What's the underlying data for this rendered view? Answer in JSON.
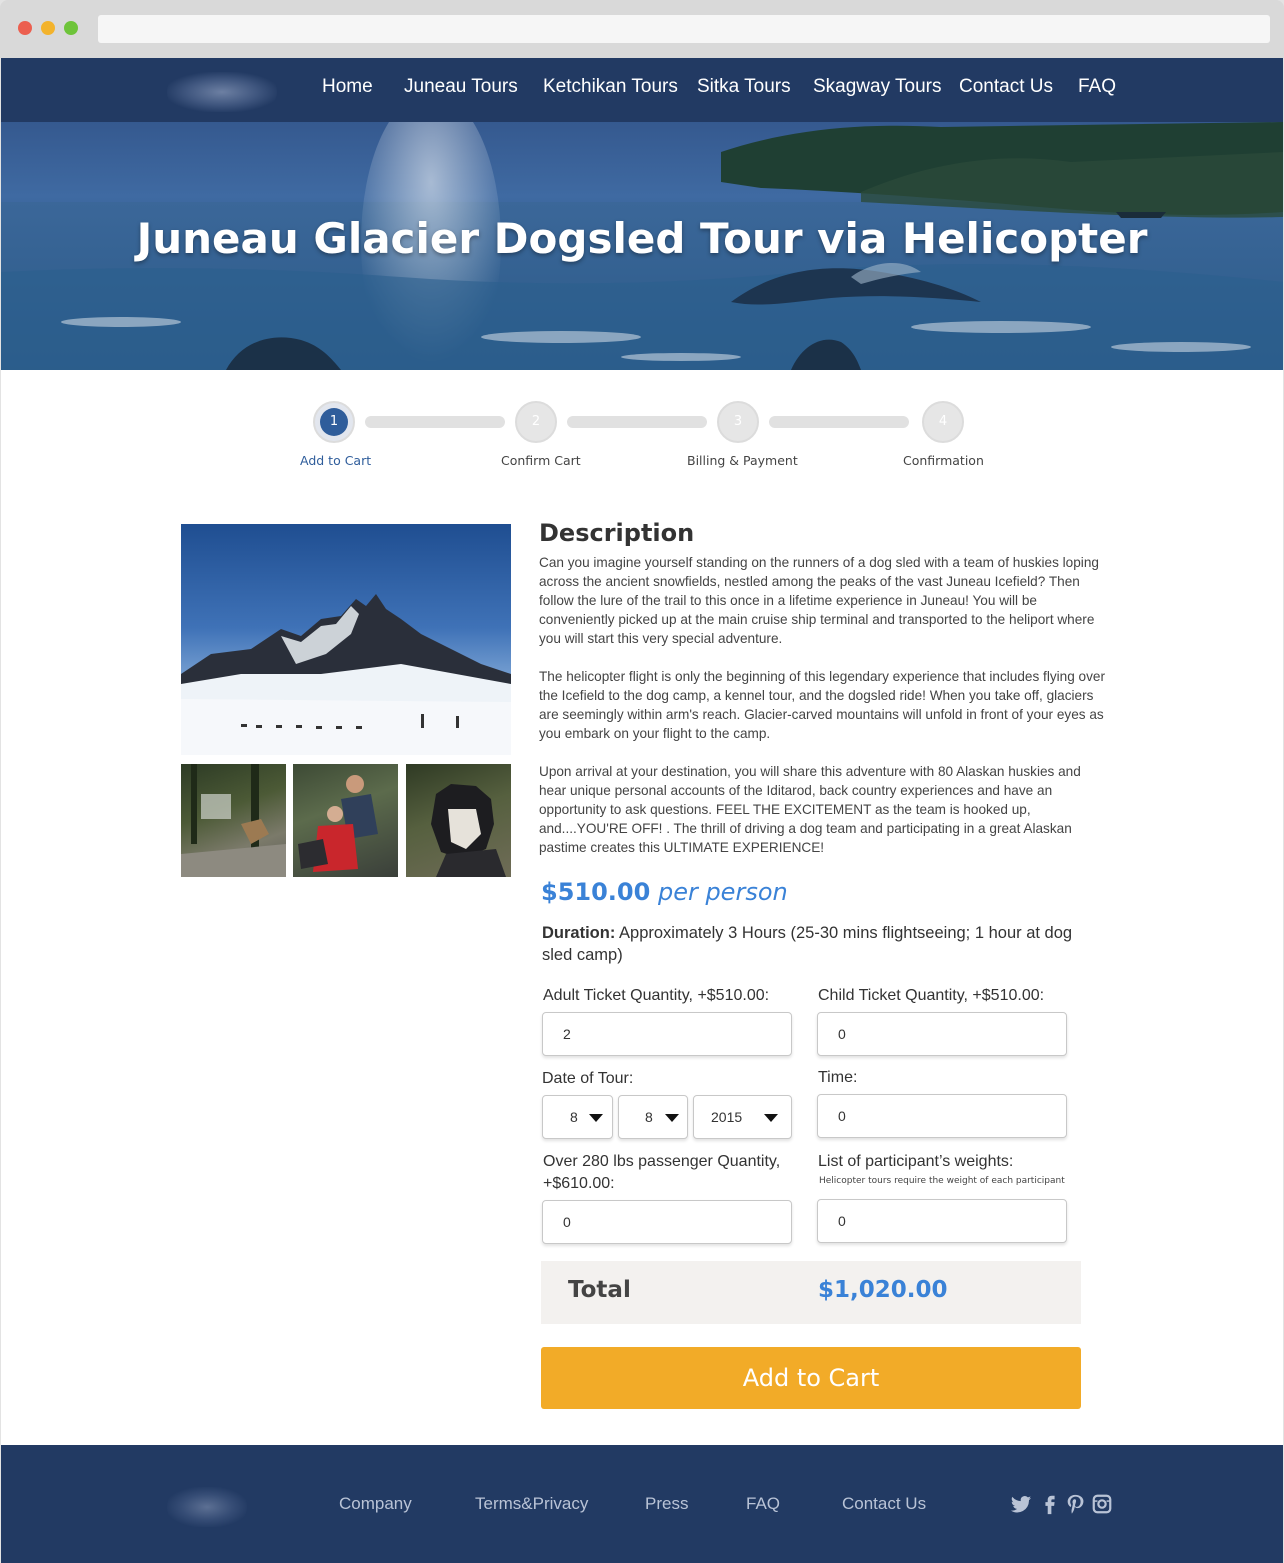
{
  "nav": {
    "items": [
      "Home",
      "Juneau Tours",
      "Ketchikan Tours",
      "Sitka Tours",
      "Skagway Tours",
      "Contact Us",
      "FAQ"
    ]
  },
  "hero": {
    "title": "Juneau Glacier Dogsled Tour via Helicopter"
  },
  "stepper": {
    "current": 1,
    "steps": [
      {
        "num": "1",
        "label": "Add to Cart"
      },
      {
        "num": "2",
        "label": "Confirm Cart"
      },
      {
        "num": "3",
        "label": "Billing & Payment"
      },
      {
        "num": "4",
        "label": "Confirmation"
      }
    ]
  },
  "description": {
    "title": "Description",
    "paragraphs": [
      "Can you imagine yourself standing on the runners of a dog sled with a team of huskies loping across the ancient snowfields, nestled among the peaks of the vast Juneau Icefield? Then follow the lure of the trail to this once in a lifetime experience in Juneau! You will be conveniently picked up at the main cruise ship terminal and transported to the heliport where you will start this very special adventure.",
      "The helicopter flight is only the beginning of this legendary experience that includes flying over the Icefield to the dog camp, a kennel tour, and the dogsled ride! When you take off, glaciers are seemingly within arm's reach. Glacier-carved mountains will unfold in front of your eyes as you embark on your flight to the camp.",
      "Upon arrival at your destination, you will share this adventure with 80 Alaskan huskies and hear unique personal accounts of the Iditarod, back country experiences and have an opportunity to ask questions. FEEL THE EXCITEMENT as the team is hooked up, and....YOU'RE OFF! . The thrill of driving a dog team and participating in a great Alaskan pastime creates this ULTIMATE EXPERIENCE!"
    ]
  },
  "pricing": {
    "amount": "$510.00",
    "unit": "per person",
    "duration_label": "Duration:",
    "duration_text": "Approximately 3 Hours (25-30 mins flightseeing; 1 hour at dog sled camp)"
  },
  "form": {
    "adult_label": "Adult Ticket Quantity, +$510.00:",
    "adult_value": "2",
    "child_label": "Child Ticket Quantity, +$510.00:",
    "child_value": "0",
    "date_label": "Date of Tour:",
    "date_month": "8",
    "date_day": "8",
    "date_year": "2015",
    "time_label": "Time:",
    "time_value": "0",
    "over_label": "Over 280 lbs passenger Quantity, +$610.00:",
    "over_value": "0",
    "weights_label": "List of participant’s weights:",
    "weights_note": "Helicopter tours require the weight of each participant",
    "weights_value": "0"
  },
  "total": {
    "label": "Total",
    "value": "$1,020.00"
  },
  "cta": {
    "label": "Add to Cart"
  },
  "footer": {
    "links": [
      "Company",
      "Terms&Privacy",
      "Press",
      "FAQ",
      "Contact Us"
    ],
    "social_icons": [
      "twitter-icon",
      "facebook-icon",
      "pinterest-icon",
      "instagram-icon"
    ]
  },
  "colors": {
    "navy": "#223a63",
    "accent_blue": "#3a82d7",
    "step_active": "#2f5d9b",
    "cta_orange": "#f2ab28"
  }
}
